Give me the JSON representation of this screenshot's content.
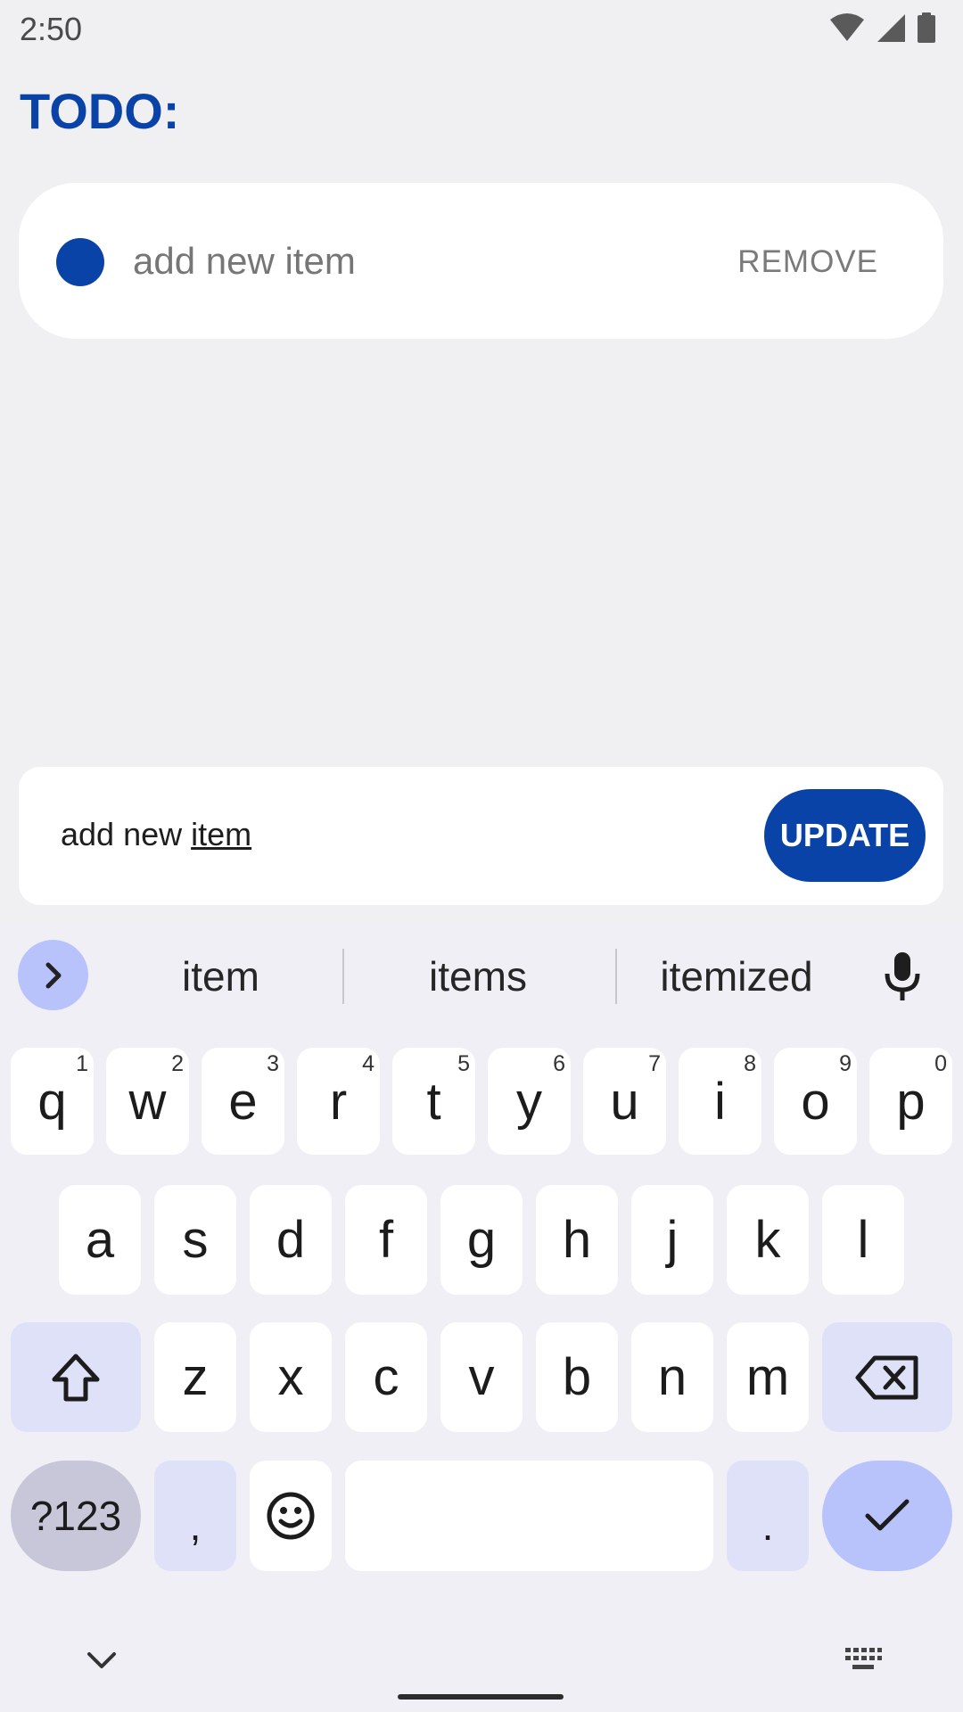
{
  "status_bar": {
    "time": "2:50"
  },
  "app": {
    "title": "TODO:"
  },
  "todo_list": [
    {
      "text": "add new item",
      "remove_label": "REMOVE"
    }
  ],
  "editor": {
    "value_prefix": "add new ",
    "value_composing": "item",
    "update_label": "UPDATE"
  },
  "keyboard": {
    "suggestions": [
      "item",
      "items",
      "itemized"
    ],
    "row1": [
      {
        "key": "q",
        "hint": "1"
      },
      {
        "key": "w",
        "hint": "2"
      },
      {
        "key": "e",
        "hint": "3"
      },
      {
        "key": "r",
        "hint": "4"
      },
      {
        "key": "t",
        "hint": "5"
      },
      {
        "key": "y",
        "hint": "6"
      },
      {
        "key": "u",
        "hint": "7"
      },
      {
        "key": "i",
        "hint": "8"
      },
      {
        "key": "o",
        "hint": "9"
      },
      {
        "key": "p",
        "hint": "0"
      }
    ],
    "row2": [
      "a",
      "s",
      "d",
      "f",
      "g",
      "h",
      "j",
      "k",
      "l"
    ],
    "row3": [
      "z",
      "x",
      "c",
      "v",
      "b",
      "n",
      "m"
    ],
    "symbols_label": "?123",
    "comma_label": ",",
    "period_label": "."
  },
  "colors": {
    "accent": "#0a43a8",
    "background": "#f0eff1",
    "keyboard_background": "#f1eff6",
    "key_modifier": "#dfe1f8",
    "key_action": "#b9c3fb"
  }
}
